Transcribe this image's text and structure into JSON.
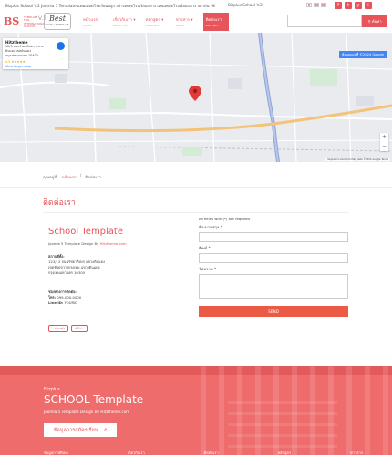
{
  "topbar": {
    "text": "Bizplus School V.2 Joomla 5 Template แทมเพลตโรงเรียนปลูก สร้างเพลตโรงเรียนกลาง แทมเพลตโรงเรียนกลาง สถาบัน Hitztheme.com",
    "center": "Bizplus School V.2",
    "social": [
      "f",
      "t",
      "y",
      "i"
    ]
  },
  "header": {
    "logo_mark": "BS",
    "logo_text": "TEMPLATE FOR INTERNATIONAL SCHOOL",
    "logo_version": "V.2",
    "logo2_main": "Best",
    "logo2_sub": "JOOMLA 5 TEMPLATE",
    "nav": [
      {
        "label": "หน้าแรก",
        "sub": "HOME",
        "active": false
      },
      {
        "label": "เกี่ยวกับเรา ▾",
        "sub": "ABOUT US",
        "active": false
      },
      {
        "label": "หลักสูตร ▾",
        "sub": "COURSES",
        "active": false
      },
      {
        "label": "ข่าวสาร ▾",
        "sub": "NEWS",
        "active": false
      },
      {
        "label": "ติดต่อเรา",
        "sub": "CONTACT",
        "active": true
      }
    ],
    "search_placeholder": "",
    "search_button": "ค้นหา"
  },
  "map": {
    "card_title": "Hitztheme",
    "card_addr": "12/3 ถนนรัชดาภิเษก, แขวงดินแดง เขตดินแดง กรุงเทพมหานคร 10400",
    "card_rating": "4.5 ★★★★★",
    "card_link": "View larger map",
    "notice": "ข้อมูลแผนที่ ©2024 Google",
    "attr": "Keyboard shortcuts  Map data ©2024 Google  Terms"
  },
  "breadcrumb": {
    "prefix": "คุณอยู่ที่:",
    "home": "หน้าแรก",
    "sep": "/",
    "current": "ติดต่อเรา"
  },
  "page_title": "ติดต่อเรา",
  "contact_info": {
    "title": "School Template",
    "byline_prefix": "Joomla 5 Template Design By",
    "byline_link": "Hitztheme.com",
    "address_heading": "สถานที่ตั้ง:",
    "address_lines": [
      "123/12 ถนนรัชดาภิเษก แขวงดินแดง",
      "เขตห้วยขวางกรุงเทพ แขวงดินแดง",
      "กรุงเทพมหานคร 10300"
    ],
    "contact_heading": "ช่องทางการติดต่อ:",
    "phone_label": "โทร:",
    "phone": "099-000-0000",
    "line_label": "Line ID:",
    "line": "YOURID",
    "prev": "« ก่อนหน้า",
    "next": "ถัดไป »"
  },
  "form": {
    "required_note": "All fields with (*) are required",
    "name_label": "ชื่อ-นามสกุล *",
    "email_label": "อีเมล์ *",
    "message_label": "ข้อความ *",
    "send_label": "SEND"
  },
  "footer": {
    "subtitle": "Bizplus",
    "title": "SCHOOL Template",
    "byline_prefix": "Joomla 5 Template Design By",
    "byline_link": "Hitztheme.com",
    "button": "ข้อมูลการสมัครเรียน",
    "button_arrow": "↗",
    "links": [
      "ข้อมูลการศึกษา",
      "เกี่ยวกับเรา",
      "ติดต่อเรา",
      "หลักสูตร",
      "ข่าวสาร"
    ]
  },
  "colors": {
    "accent": "#e7545a",
    "footer_bg": "#ee6c6c",
    "send_btn": "#ea5a44"
  }
}
